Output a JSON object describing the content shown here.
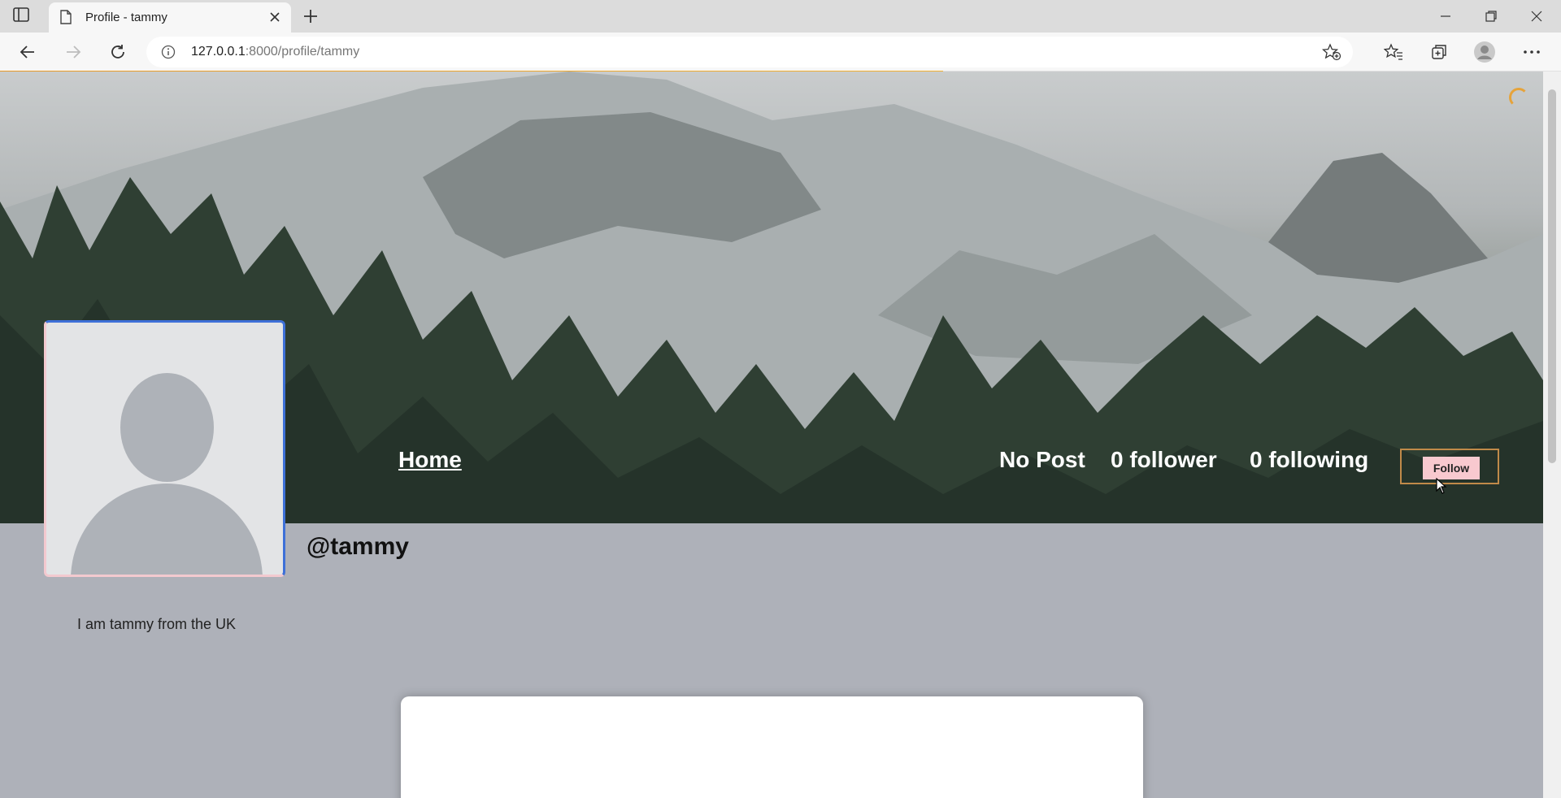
{
  "browser": {
    "tab_title": "Profile - tammy",
    "url_host": "127.0.0.1",
    "url_rest": ":8000/profile/tammy"
  },
  "colors": {
    "page_bg": "#aeb1b9",
    "follow_button": "#f8c9cf",
    "load_bar": "#e89a27"
  },
  "nav": {
    "home_label": "Home"
  },
  "stats": {
    "posts": "No Post",
    "followers": "0 follower",
    "following": "0 following"
  },
  "follow_label": "Follow",
  "profile": {
    "username": "@tammy",
    "bio": "I am tammy from the UK"
  },
  "icons": {
    "browser": [
      "tab-actions-icon",
      "document-icon",
      "close-icon",
      "plus-icon",
      "minimize-icon",
      "restore-icon",
      "close-window-icon",
      "back-icon",
      "forward-icon",
      "refresh-icon",
      "info-icon",
      "favorite-add-icon",
      "favorites-icon",
      "collections-icon",
      "profile-icon",
      "more-icon"
    ],
    "page": [
      "avatar-placeholder-icon",
      "loading-spinner-icon",
      "mouse-cursor-icon"
    ]
  }
}
